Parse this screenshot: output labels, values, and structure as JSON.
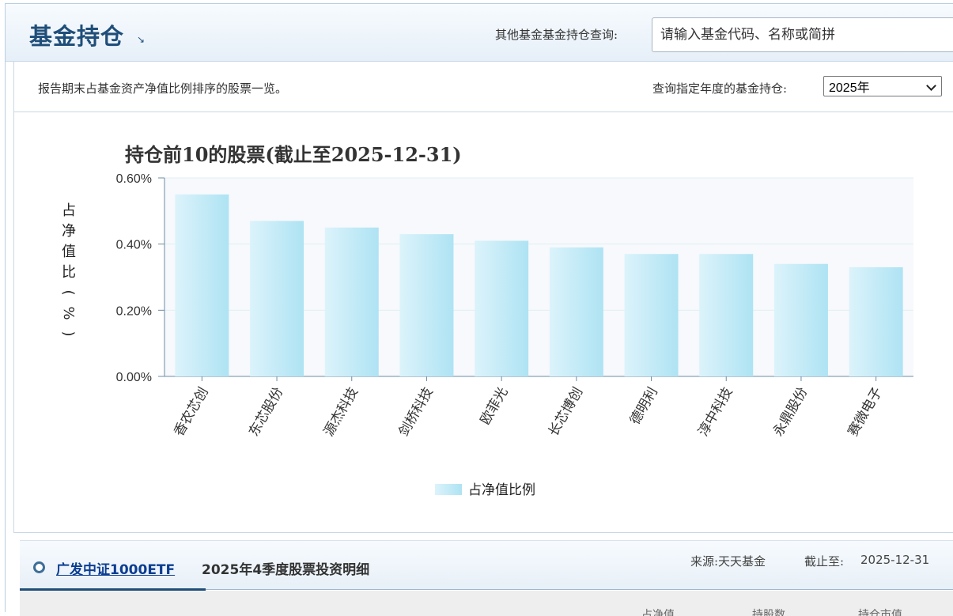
{
  "header": {
    "title": "基金持仓",
    "query_label": "其他基金基金持仓查询:",
    "search_placeholder": "请输入基金代码、名称或简拼"
  },
  "info": {
    "description": "报告期末占基金资产净值比例排序的股票一览。",
    "year_label": "查询指定年度的基金持仓:",
    "year_value": "2025年"
  },
  "chart_data": {
    "type": "bar",
    "title": "持仓前10的股票(截止至2025-12-31)",
    "ylabel": "占净值比(%)",
    "ylim": [
      0,
      0.6
    ],
    "yticks": [
      "0.00%",
      "0.20%",
      "0.40%",
      "0.60%"
    ],
    "categories": [
      "香农芯创",
      "东芯股份",
      "源杰科技",
      "剑桥科技",
      "欧菲光",
      "长芯博创",
      "德明利",
      "淳中科技",
      "永鼎股份",
      "赛微电子"
    ],
    "series": [
      {
        "name": "占净值比例",
        "values": [
          0.55,
          0.47,
          0.45,
          0.43,
          0.41,
          0.39,
          0.37,
          0.37,
          0.34,
          0.33
        ]
      }
    ],
    "legend_position": "bottom",
    "grid": true,
    "colors": {
      "bar_top": "#aee3f3",
      "bar_bottom": "#dcf3fb",
      "grid": "#e2eef4"
    }
  },
  "detail": {
    "fund_name": "广发中证1000ETF",
    "title": "2025年4季度股票投资明细",
    "source_label": "来源:天天基金",
    "deadline_label": "截止至:",
    "deadline_value": "2025-12-31"
  },
  "table_headers_partial": [
    "占净值",
    "持股数",
    "持仓市值"
  ],
  "colors": {
    "brand": "#1f4e79",
    "link": "#0b3d91"
  }
}
